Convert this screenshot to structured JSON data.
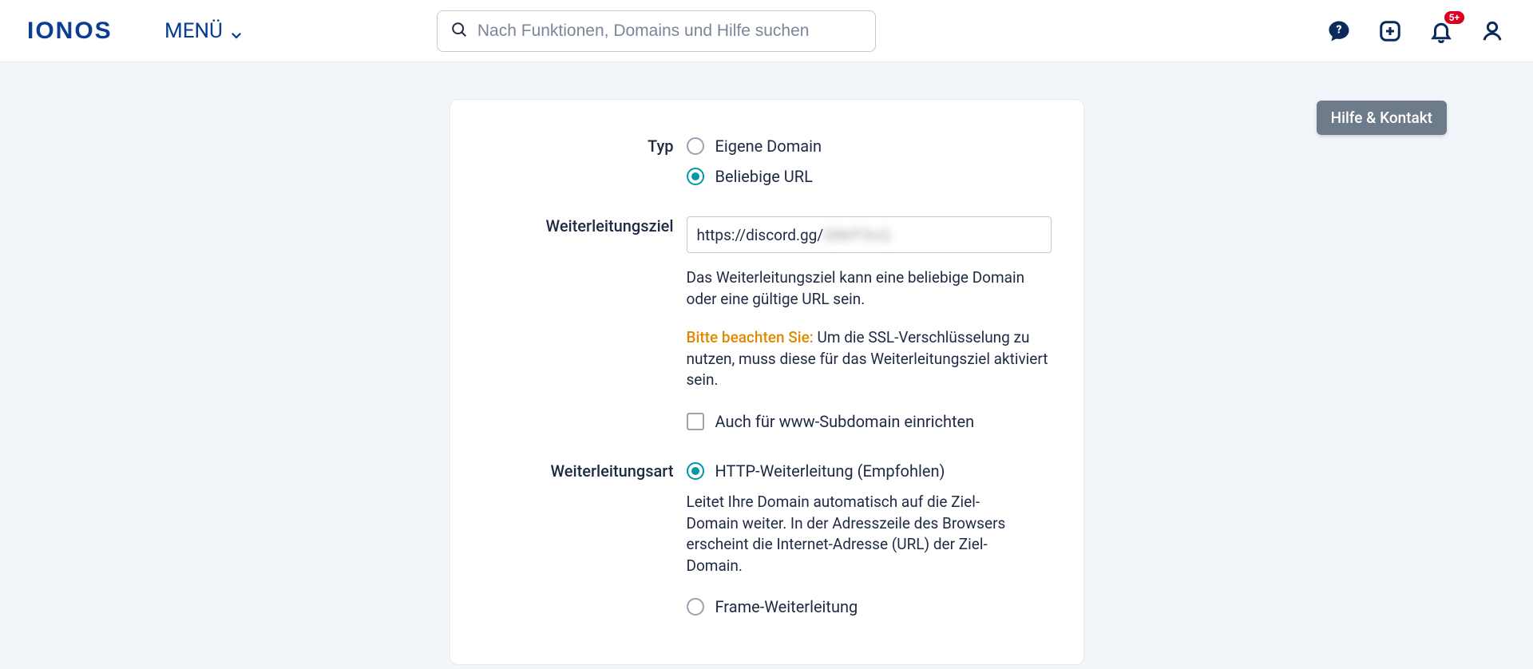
{
  "header": {
    "logo": "IONOS",
    "menu": "MENÜ",
    "search_placeholder": "Nach Funktionen, Domains und Hilfe suchen",
    "notification_badge": "5+"
  },
  "help_button": "Hilfe & Kontakt",
  "form": {
    "type": {
      "label": "Typ",
      "option_own_domain": "Eigene Domain",
      "option_any_url": "Beliebige URL"
    },
    "target": {
      "label": "Weiterleitungsziel",
      "value": "https://discord.gg/XXXXXXX",
      "visible_value": "https://discord.gg/",
      "help": "Das Weiterleitungsziel kann eine beliebige Domain oder eine gültige URL sein.",
      "warn_prefix": "Bitte beachten Sie:",
      "warn_rest": " Um die SSL-Verschlüsselung zu nutzen, muss diese für das Weiterleitungsziel aktiviert sein.",
      "checkbox": "Auch für www-Subdomain einrichten"
    },
    "method": {
      "label": "Weiterleitungsart",
      "option_http": "HTTP-Weiterleitung (Empfohlen)",
      "help": "Leitet Ihre Domain automatisch auf die Ziel-Domain weiter. In der Adresszeile des Browsers erscheint die Internet-Adresse (URL) der Ziel-Domain.",
      "option_frame": "Frame-Weiterleitung"
    }
  }
}
